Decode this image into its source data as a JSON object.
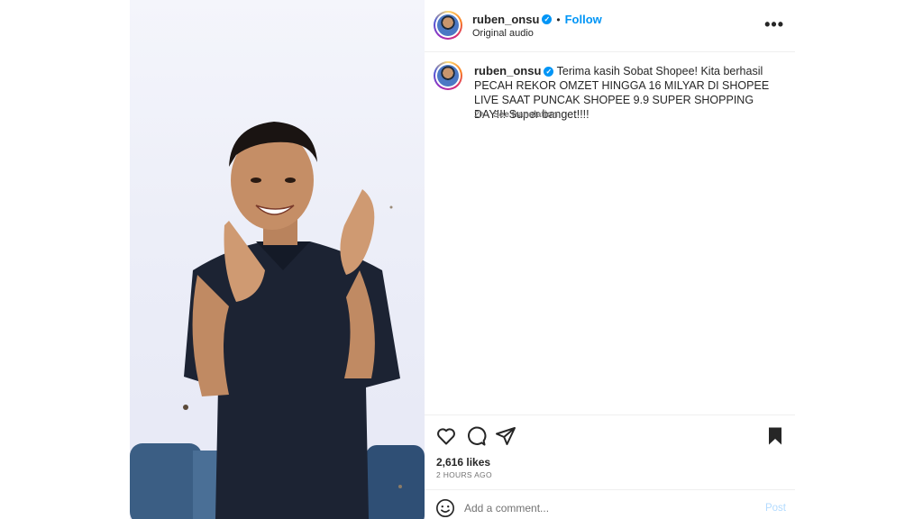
{
  "header": {
    "username": "ruben_onsu",
    "verified_glyph": "✓",
    "separator": "•",
    "follow_label": "Follow",
    "audio_label": "Original audio",
    "more_label": "•••"
  },
  "caption": {
    "username": "ruben_onsu",
    "verified_glyph": "✓",
    "text": "Terima kasih Sobat Shopee! Kita berhasil PECAH REKOR OMZET HINGGA 16 MILYAR DI SHOPEE LIVE SAAT PUNCAK SHOPEE 9.9 SUPER SHOPPING DAY!!! Super banget!!!!",
    "time": "2h",
    "translate_label": "See translation"
  },
  "actions": {
    "icons": [
      "heart-icon",
      "comment-icon",
      "share-icon",
      "bookmark-icon"
    ]
  },
  "stats": {
    "likes": "2,616 likes",
    "posted": "2 HOURS AGO"
  },
  "comment": {
    "placeholder": "Add a comment...",
    "post_label": "Post"
  },
  "colors": {
    "accent": "#0095f6",
    "text": "#262626",
    "muted": "#737373",
    "post_disabled": "#b3dbff",
    "shirt": "#1c2333"
  }
}
